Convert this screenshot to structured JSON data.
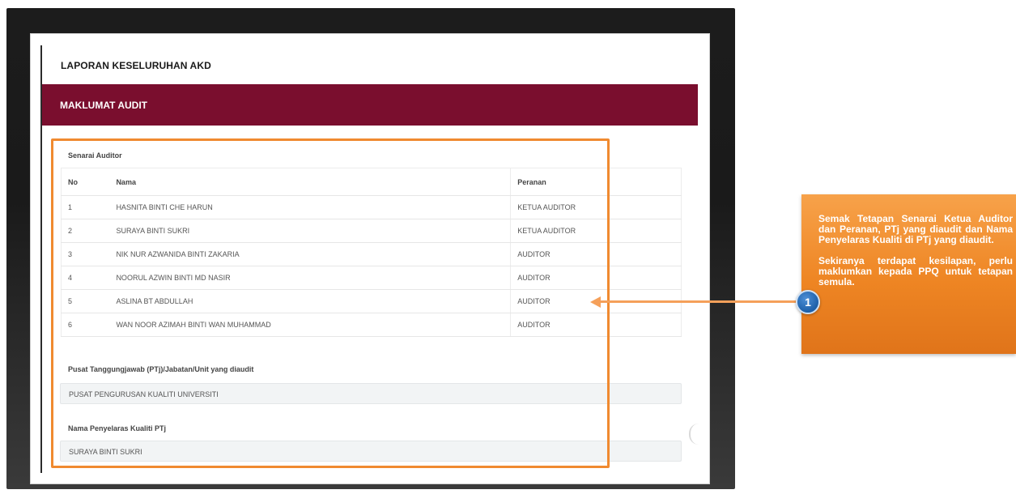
{
  "report": {
    "title": "LAPORAN KESELURUHAN AKD"
  },
  "section": {
    "title": "MAKLUMAT AUDIT"
  },
  "auditors": {
    "label": "Senarai Auditor",
    "headers": {
      "no": "No",
      "nama": "Nama",
      "peranan": "Peranan"
    },
    "rows": [
      {
        "no": "1",
        "nama": "HASNITA BINTI CHE HARUN",
        "peranan": "KETUA AUDITOR"
      },
      {
        "no": "2",
        "nama": "SURAYA BINTI SUKRI",
        "peranan": "KETUA AUDITOR"
      },
      {
        "no": "3",
        "nama": "NIK NUR AZWANIDA BINTI ZAKARIA",
        "peranan": "AUDITOR"
      },
      {
        "no": "4",
        "nama": "NOORUL AZWIN BINTI MD NASIR",
        "peranan": "AUDITOR"
      },
      {
        "no": "5",
        "nama": "ASLINA BT ABDULLAH",
        "peranan": "AUDITOR"
      },
      {
        "no": "6",
        "nama": "WAN NOOR AZIMAH BINTI WAN MUHAMMAD",
        "peranan": "AUDITOR"
      }
    ]
  },
  "ptj": {
    "label": "Pusat Tanggungjawab (PTj)/Jabatan/Unit yang diaudit",
    "value": "PUSAT PENGURUSAN KUALITI UNIVERSITI"
  },
  "coordinator": {
    "label": "Nama Penyelaras Kualiti PTj",
    "value": "SURAYA BINTI SUKRI"
  },
  "callout": {
    "number": "1",
    "paragraph1": "Semak Tetapan Senarai Ketua Auditor dan Peranan, PTj yang diaudit dan Nama Penyelaras Kualiti di PTj yang diaudit.",
    "paragraph2": "Sekiranya terdapat kesilapan, perlu maklumkan kepada PPQ untuk tetapan semula.",
    "color": "#ee8523"
  },
  "colors": {
    "banner": "#7a0e2e",
    "highlight": "#f08a30",
    "badge": "#1d5fa8"
  }
}
